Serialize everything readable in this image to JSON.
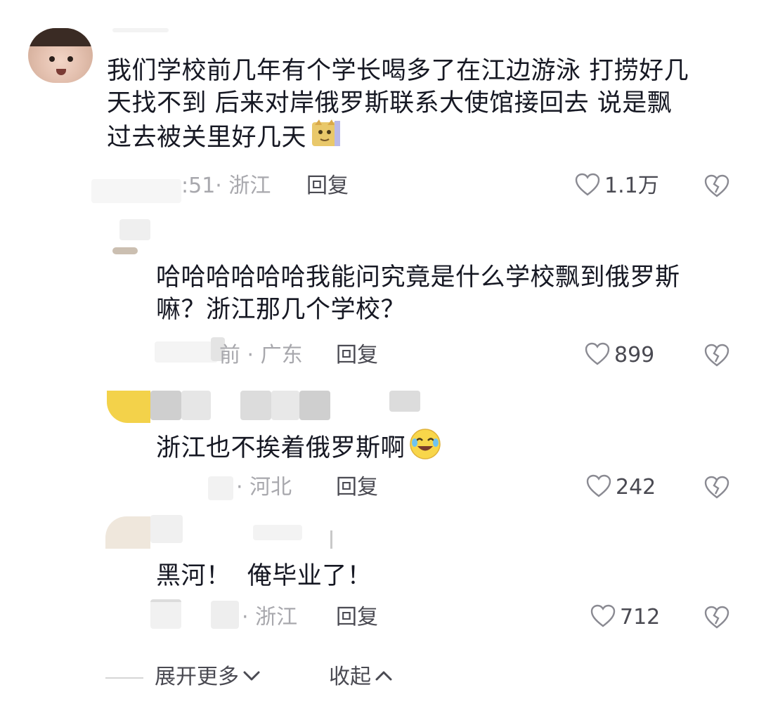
{
  "comments": [
    {
      "text_lines": [
        "我们学校前几年有个学长喝多了在江边游泳 打捞好几",
        "天找不到 后来对岸俄罗斯联系大使馆接回去 说是飘",
        "过去被关里好几天"
      ],
      "meta": ":51· 浙江",
      "reply": "回复",
      "likes": "1.1万"
    },
    {
      "text_lines": [
        "哈哈哈哈哈哈我能问究竟是什么学校飘到俄罗斯",
        "嘛？浙江那几个学校？"
      ],
      "meta": "前 · 广东",
      "reply": "回复",
      "likes": "899"
    },
    {
      "text_lines": [
        "浙江也不挨着俄罗斯啊"
      ],
      "meta": "· 河北",
      "reply": "回复",
      "likes": "242"
    },
    {
      "text_lines": [
        "黑河！  俺毕业了！"
      ],
      "meta": "· 浙江",
      "reply": "回复",
      "likes": "712"
    }
  ],
  "footer": {
    "expand_label": "展开更多",
    "collapse_label": "收起"
  },
  "icons": {
    "like": "heart-outline-icon",
    "dislike": "broken-heart-icon",
    "emoji_cat": "cat-emoji-icon",
    "emoji_cry_laugh": "crying-laughing-emoji-icon"
  },
  "colors": {
    "text_primary": "#161823",
    "text_meta": "#a8a8ad",
    "text_action": "#4a4a52"
  }
}
